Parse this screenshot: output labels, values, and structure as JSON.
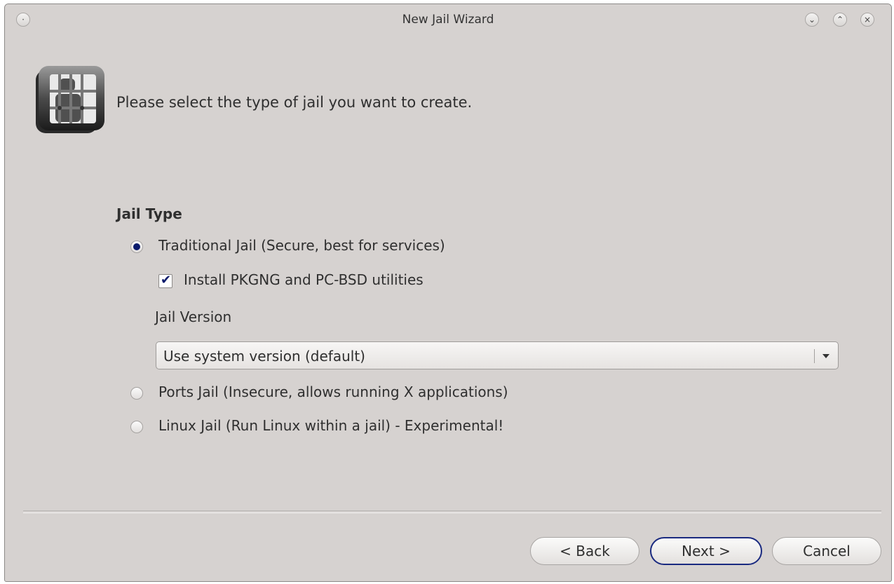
{
  "window": {
    "title": "New Jail Wizard",
    "controls": {
      "menu": "·",
      "minimize": "⌄",
      "maximize": "⌃",
      "close": "×"
    }
  },
  "page": {
    "intro": "Please select the type of jail you want to create.",
    "group_title": "Jail Type"
  },
  "options": {
    "traditional": {
      "label": "Traditional Jail (Secure, best for services)",
      "checked": true
    },
    "install_utils": {
      "label": "Install PKGNG and PC-BSD utilities",
      "checked": true
    },
    "version_label": "Jail Version",
    "version_value": "Use system version (default)",
    "ports": {
      "label": "Ports Jail (Insecure, allows running X applications)",
      "checked": false
    },
    "linux": {
      "label": "Linux Jail (Run Linux within a jail) - Experimental!",
      "checked": false
    }
  },
  "buttons": {
    "back": "< Back",
    "next": "Next >",
    "cancel": "Cancel"
  },
  "colors": {
    "window_bg": "#d6d2d0",
    "accent": "#0a1a6b"
  },
  "icons": [
    "jail-wizard-icon",
    "chevron-down-icon"
  ]
}
